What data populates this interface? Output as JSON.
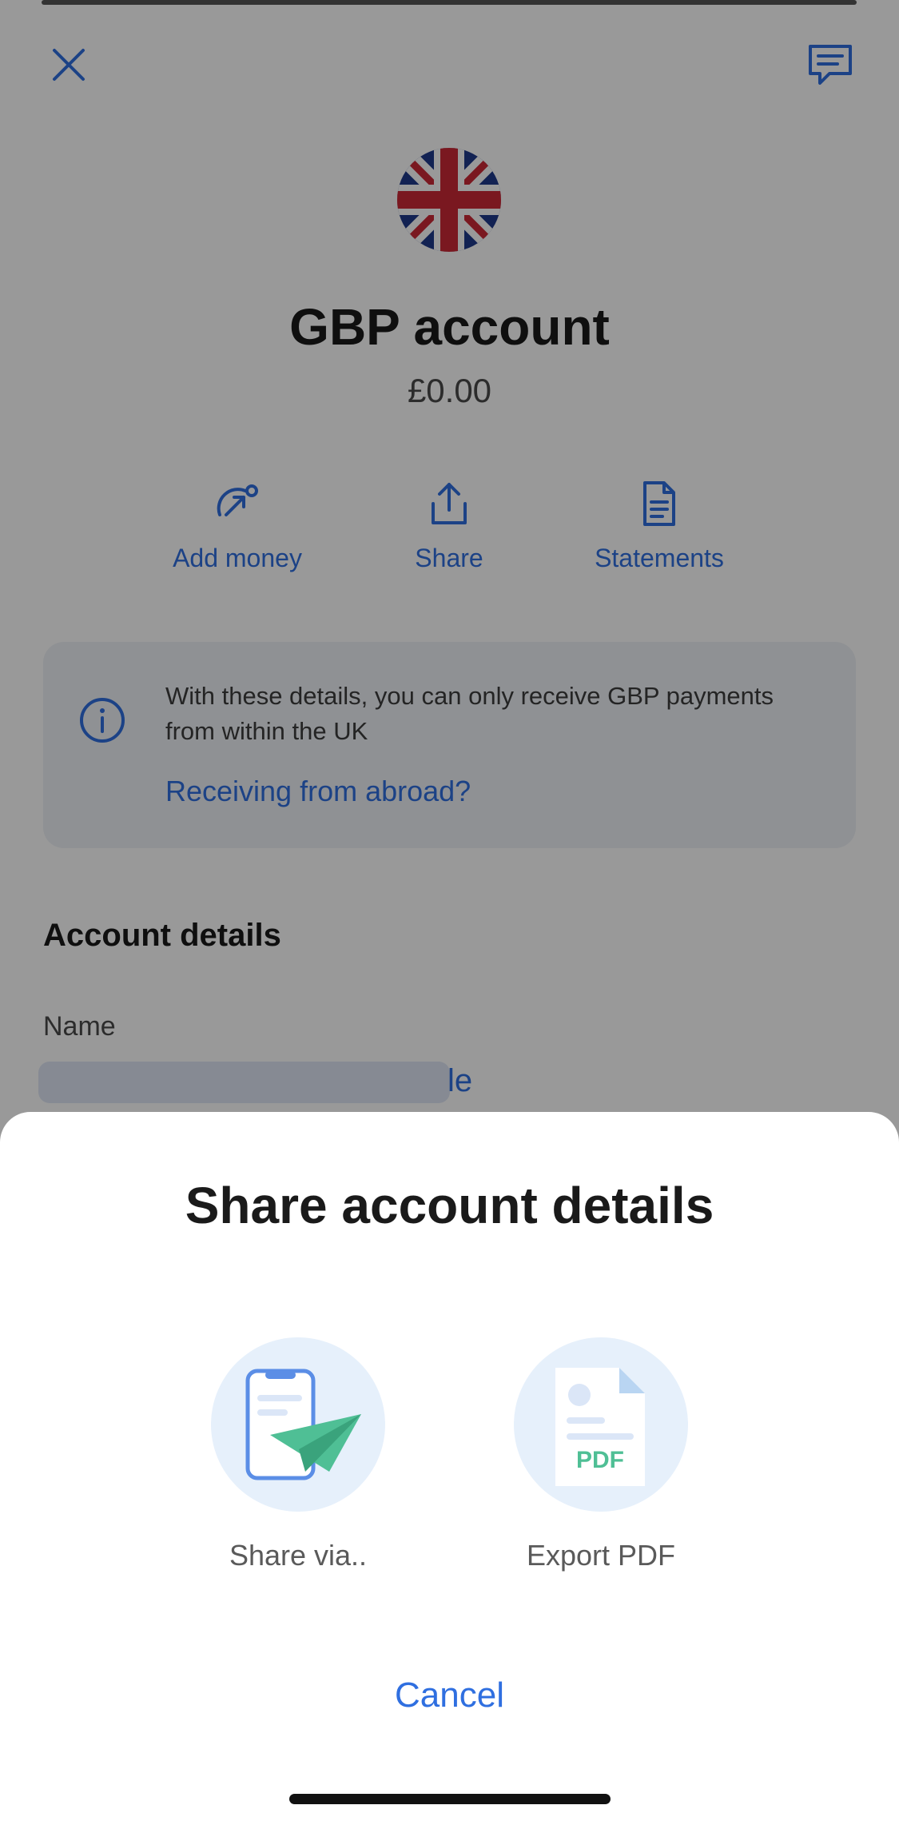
{
  "header": {
    "close_icon": "close-icon",
    "chat_icon": "chat-icon"
  },
  "account": {
    "flag_icon": "uk-flag-icon",
    "title": "GBP account",
    "balance": "£0.00"
  },
  "actions": [
    {
      "label": "Add money",
      "icon": "add-money-icon"
    },
    {
      "label": "Share",
      "icon": "share-icon"
    },
    {
      "label": "Statements",
      "icon": "document-icon"
    }
  ],
  "info": {
    "icon": "info-icon",
    "text": "With these details, you can only receive GBP payments from within the UK",
    "link": "Receiving from abroad?"
  },
  "account_details": {
    "section_title": "Account details",
    "name_label": "Name",
    "name_value_visible_tail": "le"
  },
  "sheet": {
    "title": "Share account details",
    "options": [
      {
        "label": "Share via..",
        "icon": "share-via-icon"
      },
      {
        "label": "Export PDF",
        "icon": "pdf-icon",
        "icon_text": "PDF"
      }
    ],
    "cancel": "Cancel"
  },
  "colors": {
    "accent": "#2f6fe0",
    "pdf_green": "#4fbf95"
  }
}
